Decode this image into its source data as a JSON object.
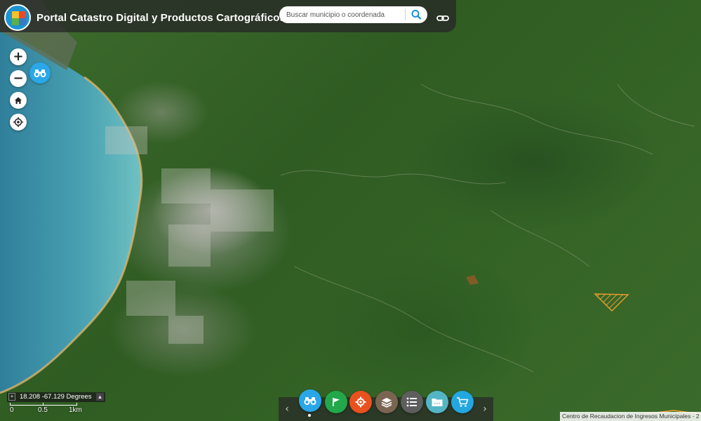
{
  "header": {
    "title": "Portal Catastro Digital y Productos Cartográficos",
    "logo_icon": "crim-logo-icon"
  },
  "search": {
    "placeholder": "Buscar municipio o coordenada",
    "button_icon": "search-icon"
  },
  "share_icon": "link-icon",
  "map_controls": {
    "zoom_in": "+",
    "zoom_out": "−",
    "home_icon": "home-icon",
    "locate_icon": "locate-icon",
    "binoculars_icon": "binoculars-icon"
  },
  "coordinates": {
    "value": "18.208 -67.129 Degrees"
  },
  "scale": {
    "labels": [
      "0",
      "0.5",
      "1km"
    ]
  },
  "toolbar": {
    "prev_icon": "chevron-left-icon",
    "next_icon": "chevron-right-icon",
    "buttons": [
      {
        "icon": "binoculars-icon",
        "color": "#2aa7e8",
        "active": true
      },
      {
        "icon": "flag-icon",
        "color": "#22a84a"
      },
      {
        "icon": "tools-icon",
        "color": "#e8521f"
      },
      {
        "icon": "layers-icon",
        "color": "#7b6552"
      },
      {
        "icon": "list-icon",
        "color": "#5e5e5e"
      },
      {
        "icon": "folder-icon",
        "color": "#54b6c4"
      },
      {
        "icon": "cart-icon",
        "color": "#23a7e0"
      }
    ]
  },
  "attribution": {
    "text": "Centro de Recaudacion de Ingresos Municipales - 2"
  },
  "colors": {
    "accent_blue": "#2aa7e8",
    "parcel_orange": "#f0a030",
    "header_bg": "#282828"
  }
}
